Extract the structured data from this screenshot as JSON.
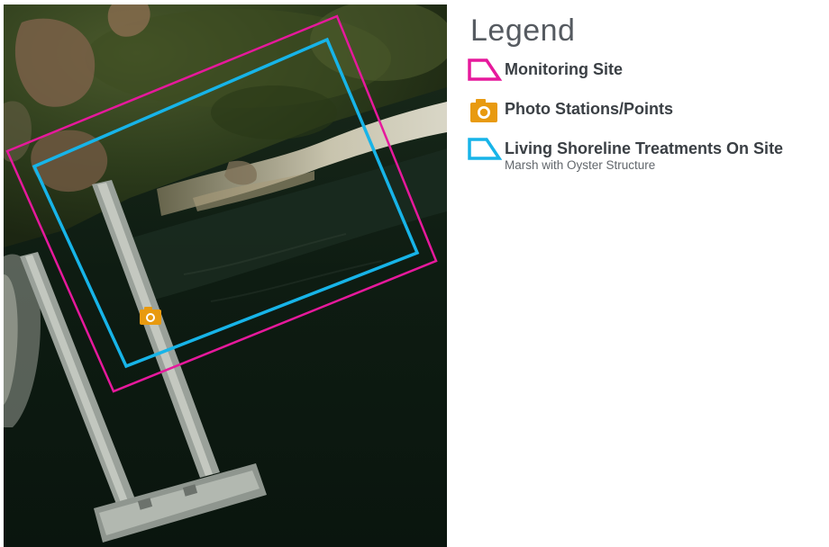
{
  "legend": {
    "title": "Legend",
    "items": [
      {
        "label": "Monitoring Site",
        "sublabel": "",
        "icon": "polygon-outline-icon",
        "color": "#e6199c"
      },
      {
        "label": "Photo Stations/Points",
        "sublabel": "",
        "icon": "camera-icon",
        "color": "#e89a10"
      },
      {
        "label": "Living Shoreline Treatments On Site",
        "sublabel": "Marsh with Oyster Structure",
        "icon": "polygon-outline-icon",
        "color": "#17b4e8"
      }
    ]
  },
  "map": {
    "basemap": "satellite-imagery",
    "features": [
      {
        "type": "monitoring-site",
        "color": "#e6199c"
      },
      {
        "type": "living-shoreline-treatment",
        "color": "#17b4e8"
      },
      {
        "type": "photo-station",
        "color": "#e89a10"
      }
    ]
  }
}
